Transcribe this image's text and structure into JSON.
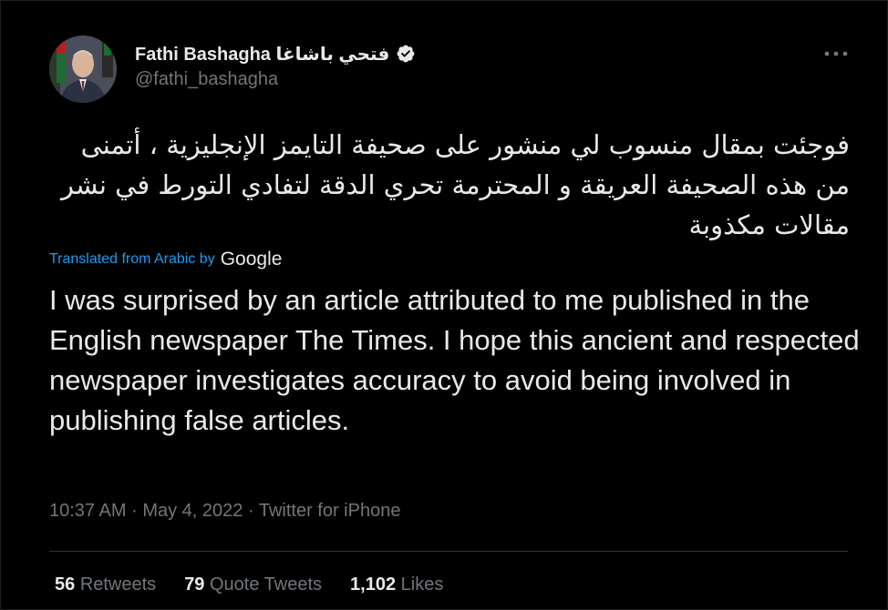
{
  "tweet": {
    "author": {
      "display_name": "Fathi Bashagha فتحي باشاغا",
      "handle": "@fathi_bashagha",
      "verified_icon": "verified-badge-icon",
      "avatar_icon": "profile-photo"
    },
    "more_icon": "more-options-icon",
    "original_text": "فوجئت بمقال منسوب لي منشور على صحيفة التايمز الإنجليزية ، أتمنى من هذه الصحيفة العريقة و المحترمة تحري الدقة لتفادي التورط في نشر مقالات مكذوبة",
    "translation": {
      "label": "Translated from Arabic by",
      "provider": "Google"
    },
    "translated_text": "I was surprised by an article attributed to me published in the English newspaper The Times. I hope this ancient and respected newspaper investigates accuracy to avoid being involved in publishing false articles.",
    "meta": {
      "time": "10:37 AM",
      "separator": "·",
      "date": "May 4, 2022",
      "source": "Twitter for iPhone"
    },
    "stats": {
      "retweets_count": "56",
      "retweets_label": "Retweets",
      "quote_tweets_count": "79",
      "quote_tweets_label": "Quote Tweets",
      "likes_count": "1,102",
      "likes_label": "Likes"
    }
  },
  "colors": {
    "background": "#000000",
    "text_primary": "#e7e9ea",
    "text_secondary": "#71767b",
    "link_blue": "#1d9bf0",
    "divider": "#2f3336"
  }
}
